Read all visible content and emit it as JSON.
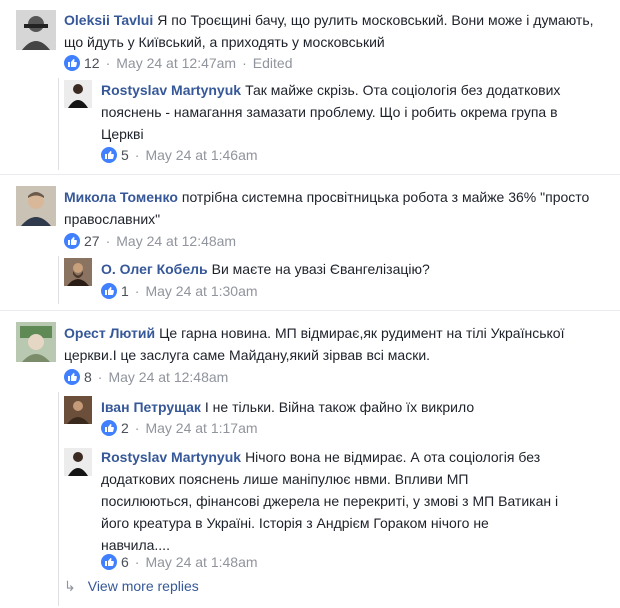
{
  "comments": [
    {
      "author": "Oleksii Tavlui",
      "text": "Я по Троєщині бачу, що рулить московський. Вони може і думають, що йдуть у Київський, а приходять у московський",
      "likes": "12",
      "date": "May 24 at 12:47am",
      "edited": "Edited",
      "replies": [
        {
          "author": "Rostyslav Martynyuk",
          "text": "Так майже скрізь. Ота соціологія без додаткових пояснень - намагання замазати проблему. Що і робить окрема група в Церкві",
          "likes": "5",
          "date": "May 24 at 1:46am"
        }
      ]
    },
    {
      "author": "Микола Томенко",
      "text": "потрібна системна просвітницька робота з майже 36% \"просто православних\"",
      "likes": "27",
      "date": "May 24 at 12:48am",
      "replies": [
        {
          "author": "О. Олег Кобель",
          "text": "Ви маєте на увазі Євангелізацію?",
          "likes": "1",
          "date": "May 24 at 1:30am"
        }
      ]
    },
    {
      "author": "Орест Лютий",
      "text": "Це гарна новина. МП відмирає,як рудимент на тілі Української церкви.І це заслуга саме Майдану,який зірвав всі маски.",
      "likes": "8",
      "date": "May 24 at 12:48am",
      "replies": [
        {
          "author": "Іван Петрущак",
          "text": "І не тільки. Війна також файно їх викрило",
          "likes": "2",
          "date": "May 24 at 1:17am"
        },
        {
          "author": "Rostyslav Martynyuk",
          "text": "Нічого вона не відмирає. А ота соціологія без додаткових пояснень лише маніпулює нвми. Впливи МП посилюються, фінансові джерела не перекриті, у змові з МП Ватикан і його креатура в Україні. Історія з Андрієм Гораком нічого не навчила....",
          "likes": "6",
          "date": "May 24 at 1:48am"
        }
      ]
    }
  ],
  "view_more": "View more replies",
  "colors": {
    "link": "#365899",
    "meta": "#90949c",
    "like_blue": "#4080ff"
  },
  "icons": {
    "like": "like-thumb-icon",
    "reply_arrow": "reply-arrow-icon"
  }
}
